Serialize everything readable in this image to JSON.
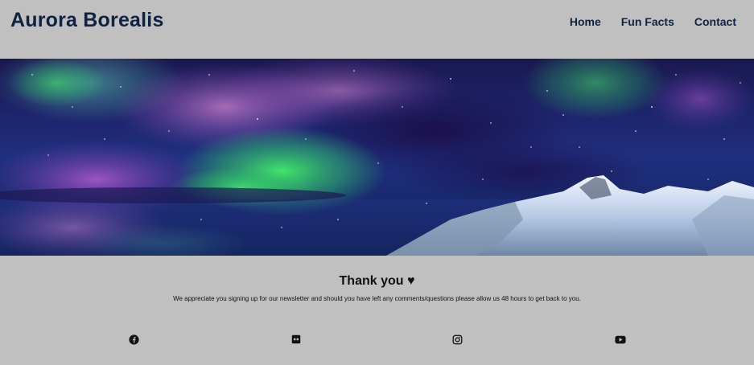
{
  "header": {
    "brand": "Aurora Borealis",
    "nav": [
      {
        "label": "Home"
      },
      {
        "label": "Fun Facts"
      },
      {
        "label": "Contact"
      }
    ]
  },
  "hero": {
    "image": "aurora-mountain-image"
  },
  "thankyou": {
    "title": "Thank you ♥",
    "message": "We appreciate you signing up for our newsletter and should you have left any comments/questions please allow us 48 hours to get back to you."
  },
  "social": {
    "icons": [
      "facebook-icon",
      "flickr-icon",
      "instagram-icon",
      "youtube-icon"
    ]
  }
}
